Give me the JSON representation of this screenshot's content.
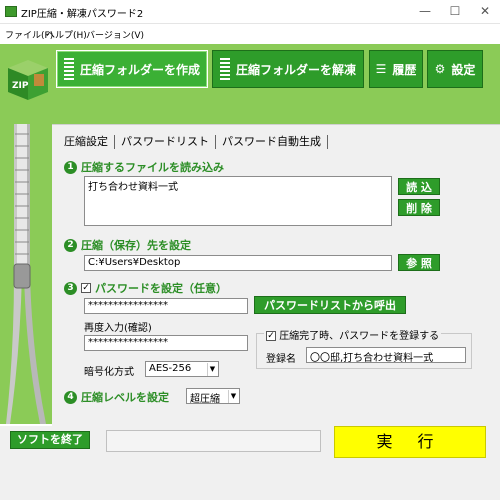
{
  "window": {
    "title": "ZIP圧縮・解凍パスワード2",
    "minimize": "—",
    "maximize": "☐",
    "close": "✕"
  },
  "menu": [
    "ファイル(F)",
    "ヘルプ(H)",
    "バージョン(V)"
  ],
  "toolbar": {
    "compress": "圧縮フォルダーを作成",
    "extract": "圧縮フォルダーを解凍",
    "history": "履歴",
    "settings": "設定"
  },
  "tabs": [
    "圧縮設定",
    "パスワードリスト",
    "パスワード自動生成"
  ],
  "section1": {
    "num": "1",
    "label": "圧縮するファイルを読み込み",
    "file_list": "打ち合わせ資料一式",
    "load_btn": "読 込",
    "delete_btn": "削 除"
  },
  "section2": {
    "num": "2",
    "label": "圧縮（保存）先を設定",
    "path": "C:¥Users¥Desktop",
    "browse_btn": "参 照"
  },
  "section3": {
    "num": "3",
    "label": "パスワードを設定（任意）",
    "checked": "✓",
    "password": "****************",
    "call_list_btn": "パスワードリストから呼出",
    "confirm_label": "再度入力(確認)",
    "password_confirm": "****************",
    "encryption_label": "暗号化方式",
    "encryption_value": "AES-256",
    "register_check_label": "圧縮完了時、パスワードを登録する",
    "register_name_label": "登録名",
    "register_name_value": "〇〇邸,打ち合わせ資料一式"
  },
  "section4": {
    "num": "4",
    "label": "圧縮レベルを設定",
    "level": "超圧縮"
  },
  "footer": {
    "quit": "ソフトを終了",
    "run": "実 行"
  }
}
